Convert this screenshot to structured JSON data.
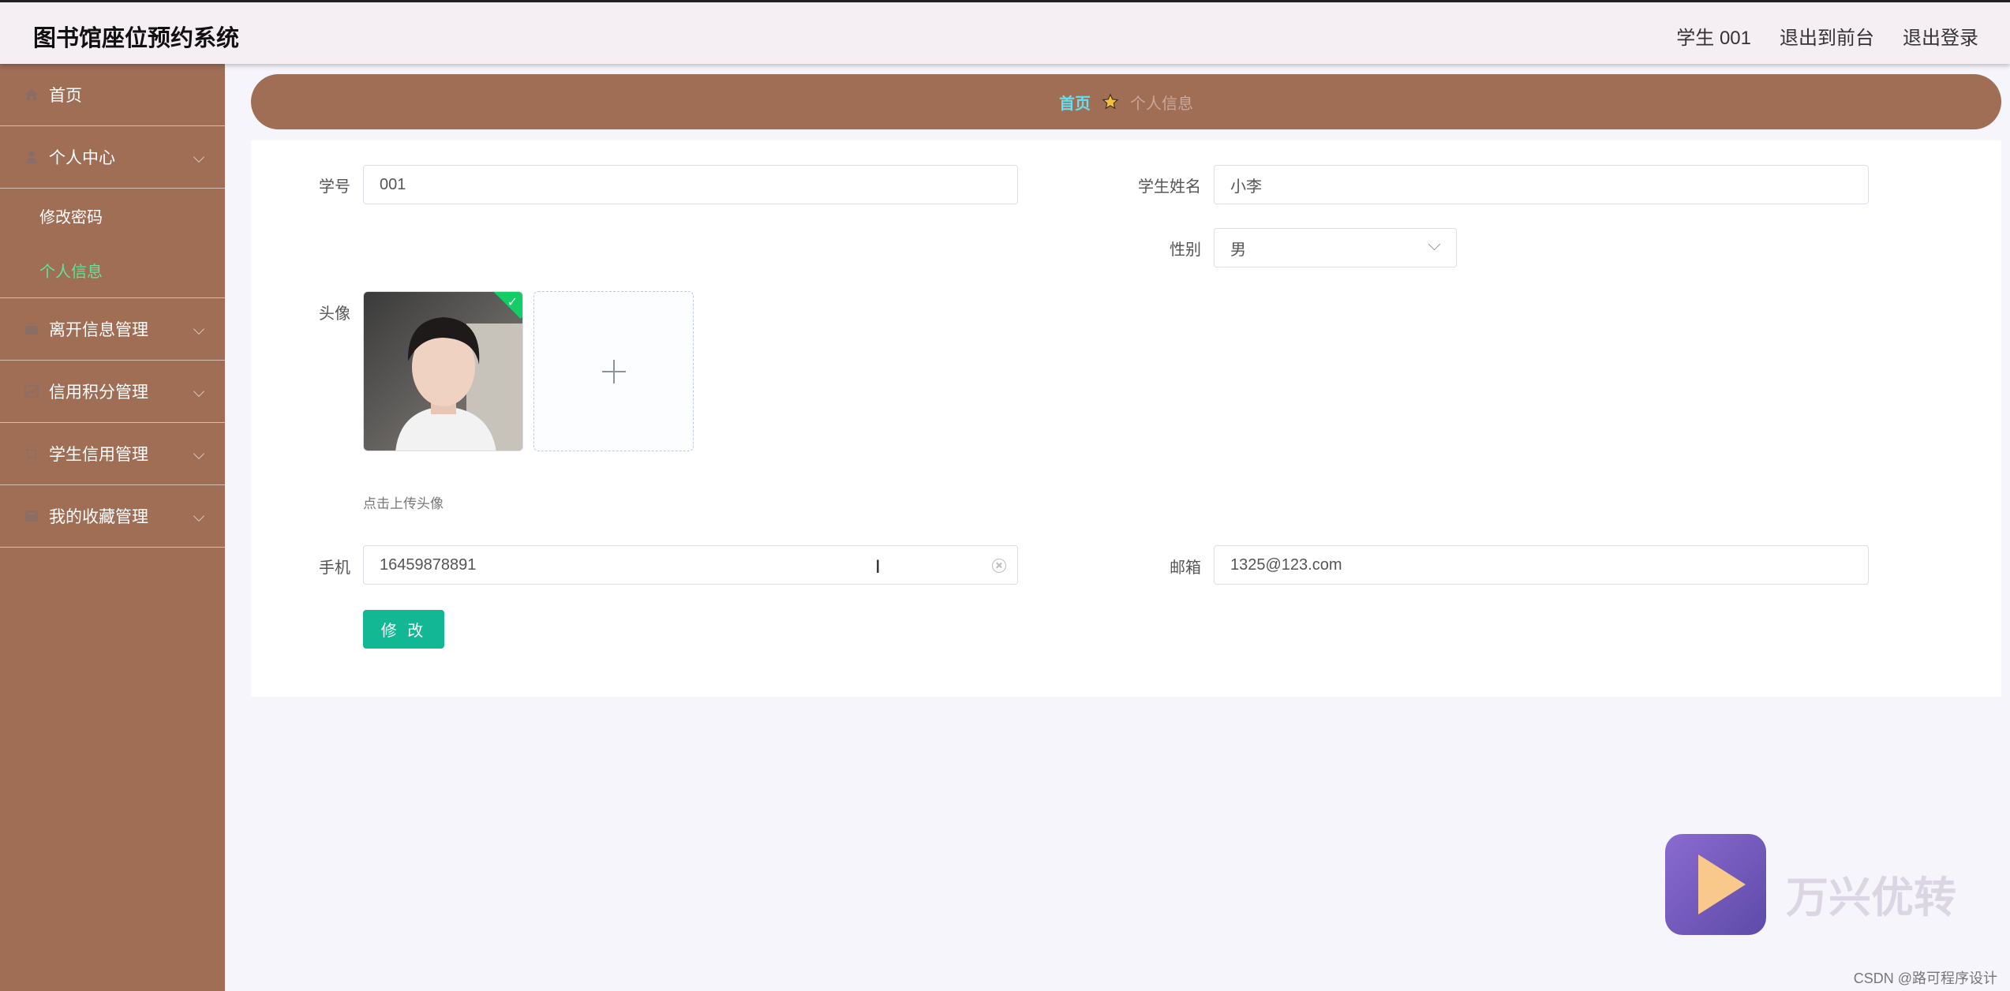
{
  "app": {
    "title": "图书馆座位预约系统"
  },
  "header": {
    "user": "学生 001",
    "to_front": "退出到前台",
    "logout": "退出登录"
  },
  "sidebar": {
    "items": [
      {
        "label": "首页",
        "icon": "home-icon"
      },
      {
        "label": "个人中心",
        "icon": "user-icon",
        "expanded": true,
        "children": [
          {
            "label": "修改密码"
          },
          {
            "label": "个人信息",
            "active": true
          }
        ]
      },
      {
        "label": "离开信息管理",
        "icon": "briefcase-icon"
      },
      {
        "label": "信用积分管理",
        "icon": "chart-icon"
      },
      {
        "label": "学生信用管理",
        "icon": "crop-icon"
      },
      {
        "label": "我的收藏管理",
        "icon": "folder-icon"
      }
    ]
  },
  "breadcrumb": {
    "home": "首页",
    "current": "个人信息",
    "accent": "#63e0ee"
  },
  "form": {
    "student_no": {
      "label": "学号",
      "value": "001"
    },
    "student_name": {
      "label": "学生姓名",
      "value": "小李"
    },
    "gender": {
      "label": "性别",
      "value": "男"
    },
    "avatar": {
      "label": "头像",
      "hint": "点击上传头像"
    },
    "phone": {
      "label": "手机",
      "value": "16459878891"
    },
    "email": {
      "label": "邮箱",
      "value": "1325@123.com"
    },
    "submit": "修 改"
  },
  "watermark": {
    "brand": "万兴优转",
    "credit": "CSDN @路可程序设计"
  },
  "colors": {
    "sidebar": "#a06d55",
    "active_submenu": "#5ee59b",
    "button": "#12b894"
  }
}
